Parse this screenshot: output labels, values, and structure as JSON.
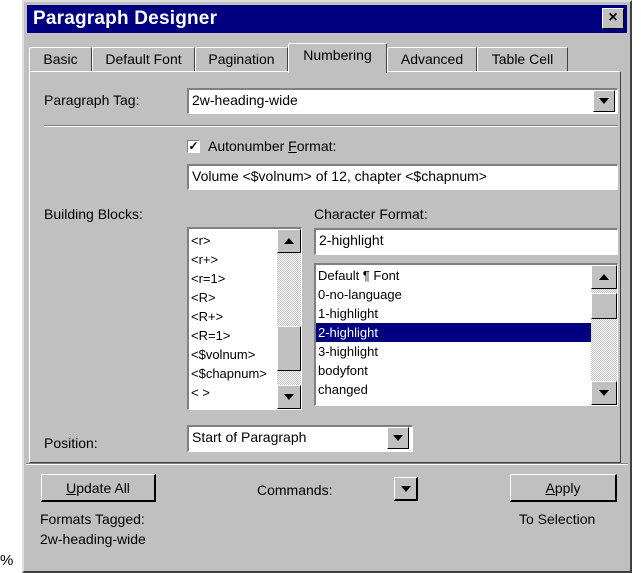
{
  "window": {
    "title": "Paragraph Designer",
    "close": "×"
  },
  "tabs": [
    {
      "label": "Basic"
    },
    {
      "label": "Default Font"
    },
    {
      "label": "Pagination"
    },
    {
      "label": "Numbering",
      "active": true
    },
    {
      "label": "Advanced"
    },
    {
      "label": "Table Cell"
    }
  ],
  "paragraph_tag": {
    "label": "Paragraph Tag:",
    "value": "2w-heading-wide"
  },
  "autonumber": {
    "checked": true,
    "check_mark": "✓",
    "label_pre": "Autonumber ",
    "label_u": "F",
    "label_post": "ormat:",
    "value": "Volume <$volnum> of 12, chapter <$chapnum>"
  },
  "building_blocks": {
    "label": "Building Blocks:",
    "items": [
      "<r>",
      "<r+>",
      "<r=1>",
      "<R>",
      "<R+>",
      "<R=1>",
      "<$volnum>",
      "<$chapnum>",
      "< >"
    ]
  },
  "character_format": {
    "label": "Character Format:",
    "value": "2-highlight",
    "items": [
      "Default ¶ Font",
      "0-no-language",
      "1-highlight",
      "2-highlight",
      "3-highlight",
      "bodyfont",
      "changed"
    ],
    "selected": "2-highlight"
  },
  "position": {
    "label": "Position:",
    "value": "Start of Paragraph"
  },
  "footer": {
    "update_all_u": "U",
    "update_all_rest": "pdate All",
    "formats_tagged_label": "Formats Tagged:",
    "formats_tagged_value": "2w-heading-wide",
    "commands_label": "Commands:",
    "apply_u": "A",
    "apply_rest": "pply",
    "apply_scope": "To Selection"
  },
  "margin_text": "%"
}
